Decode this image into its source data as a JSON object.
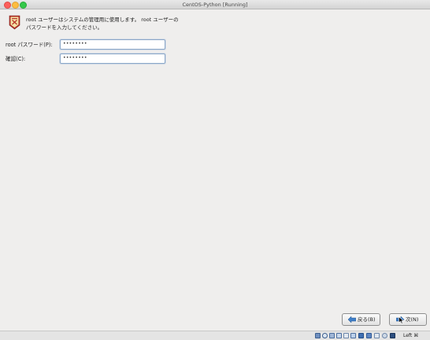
{
  "window": {
    "title": "CentOS-Python [Running]"
  },
  "header": {
    "icon": "root-user-icon",
    "description": "root ユーザーはシステムの管理用に使用します。 root ユーザーのパスワードを入力してください。"
  },
  "form": {
    "password_label": "root パスワード(P):",
    "password_value": "••••••••",
    "confirm_label": "確認(C):",
    "confirm_value": "••••••••"
  },
  "buttons": {
    "back_label": "戻る(B)",
    "next_label": "次(N)"
  },
  "statusbar": {
    "host_key": "Left ⌘",
    "icons": [
      "hard-disk-icon",
      "optical-drive-icon",
      "audio-icon",
      "usb-icon",
      "shared-folders-icon",
      "display-icon",
      "network-icon",
      "video-capture-icon",
      "cpu-icon",
      "mouse-integration-icon",
      "host-key-icon"
    ]
  },
  "colors": {
    "field_border": "#8ba7c8",
    "arrow_blue": "#3f7fc8",
    "window_bg": "#efeeed"
  }
}
